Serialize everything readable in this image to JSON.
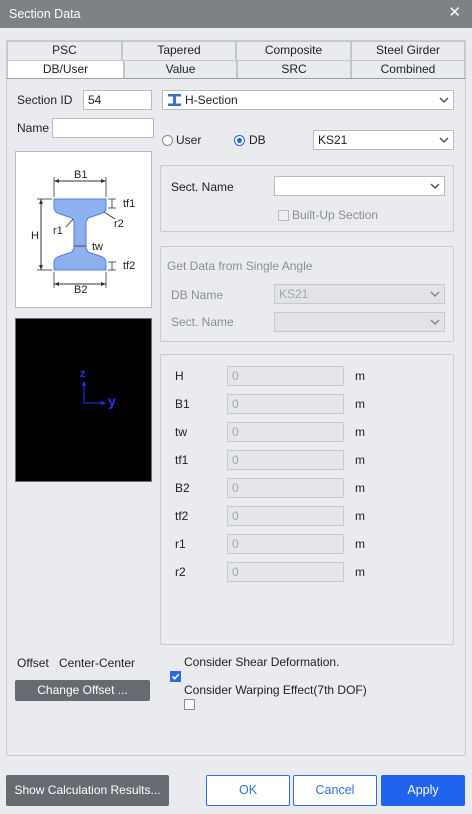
{
  "window": {
    "title": "Section Data",
    "close_glyph": "✕"
  },
  "tabs": {
    "row1": [
      "PSC",
      "Tapered",
      "Composite",
      "Steel Girder"
    ],
    "row2": [
      "DB/User",
      "Value",
      "SRC",
      "Combined"
    ],
    "active": "DB/User"
  },
  "section": {
    "id_label": "Section ID",
    "id_value": "54",
    "name_label": "Name",
    "name_value": "",
    "type_value": "H-Section",
    "type_icon": "h-section-icon"
  },
  "source": {
    "user_label": "User",
    "db_label": "DB",
    "selected": "DB",
    "db_value": "KS21"
  },
  "sect_name": {
    "label": "Sect. Name",
    "value": "",
    "builtup_label": "Built-Up Section"
  },
  "single_angle": {
    "title": "Get Data from Single Angle",
    "db_label": "DB Name",
    "db_value": "KS21",
    "sect_label": "Sect. Name",
    "sect_value": ""
  },
  "diagram": {
    "B1": "B1",
    "B2": "B2",
    "H": "H",
    "tf1": "tf1",
    "tf2": "tf2",
    "r1": "r1",
    "r2": "r2",
    "tw": "tw"
  },
  "axes": {
    "z": "z",
    "y": "y"
  },
  "dims": [
    {
      "label": "H",
      "value": "0",
      "unit": "m"
    },
    {
      "label": "B1",
      "value": "0",
      "unit": "m"
    },
    {
      "label": "tw",
      "value": "0",
      "unit": "m"
    },
    {
      "label": "tf1",
      "value": "0",
      "unit": "m"
    },
    {
      "label": "B2",
      "value": "0",
      "unit": "m"
    },
    {
      "label": "tf2",
      "value": "0",
      "unit": "m"
    },
    {
      "label": "r1",
      "value": "0",
      "unit": "m"
    },
    {
      "label": "r2",
      "value": "0",
      "unit": "m"
    }
  ],
  "offset": {
    "label": "Offset",
    "value": "Center-Center",
    "change_button": "Change Offset ..."
  },
  "options": {
    "shear_label": "Consider Shear Deformation.",
    "shear_checked": true,
    "warping_label": "Consider Warping Effect(7th DOF)",
    "warping_checked": false
  },
  "footer": {
    "calc_button": "Show Calculation Results...",
    "ok_button": "OK",
    "cancel_button": "Cancel",
    "apply_button": "Apply"
  },
  "colors": {
    "accent": "#1f63ee",
    "section_fill": "#8fb0ee",
    "preview_bg": "#000000",
    "axis_color": "#2233ff"
  }
}
